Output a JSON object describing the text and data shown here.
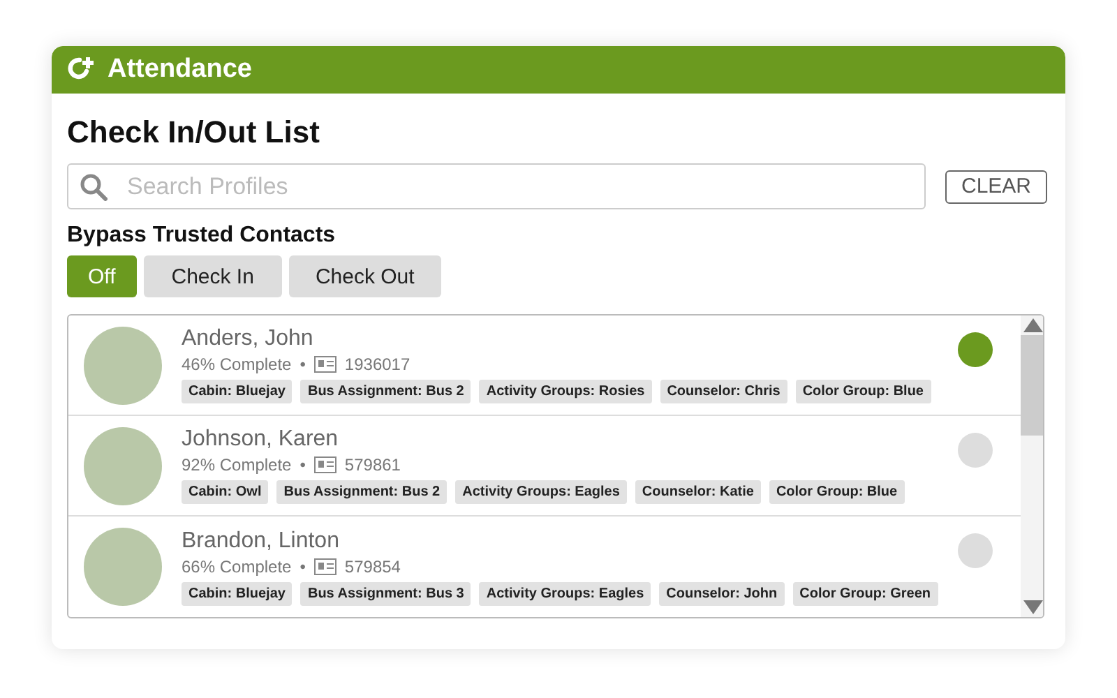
{
  "header": {
    "title": "Attendance"
  },
  "heading": "Check In/Out List",
  "search": {
    "placeholder": "Search Profiles"
  },
  "clear_button": "CLEAR",
  "bypass": {
    "label": "Bypass Trusted Contacts",
    "options": [
      {
        "label": "Off",
        "selected": true
      },
      {
        "label": "Check In",
        "selected": false
      },
      {
        "label": "Check Out",
        "selected": false
      }
    ]
  },
  "profiles": [
    {
      "name": "Anders, John",
      "progress": "46% Complete",
      "separator": "•",
      "id": "1936017",
      "checked_in": true,
      "tags": [
        "Cabin: Bluejay",
        "Bus Assignment: Bus 2",
        "Activity Groups: Rosies",
        "Counselor: Chris",
        "Color Group: Blue"
      ]
    },
    {
      "name": "Johnson, Karen",
      "progress": "92% Complete",
      "separator": "•",
      "id": "579861",
      "checked_in": false,
      "tags": [
        "Cabin: Owl",
        "Bus Assignment: Bus 2",
        "Activity Groups: Eagles",
        "Counselor: Katie",
        "Color Group: Blue"
      ]
    },
    {
      "name": "Brandon, Linton",
      "progress": "66% Complete",
      "separator": "•",
      "id": "579854",
      "checked_in": false,
      "tags": [
        "Cabin: Bluejay",
        "Bus Assignment: Bus 3",
        "Activity Groups: Eagles",
        "Counselor: John",
        "Color Group: Green"
      ]
    }
  ]
}
